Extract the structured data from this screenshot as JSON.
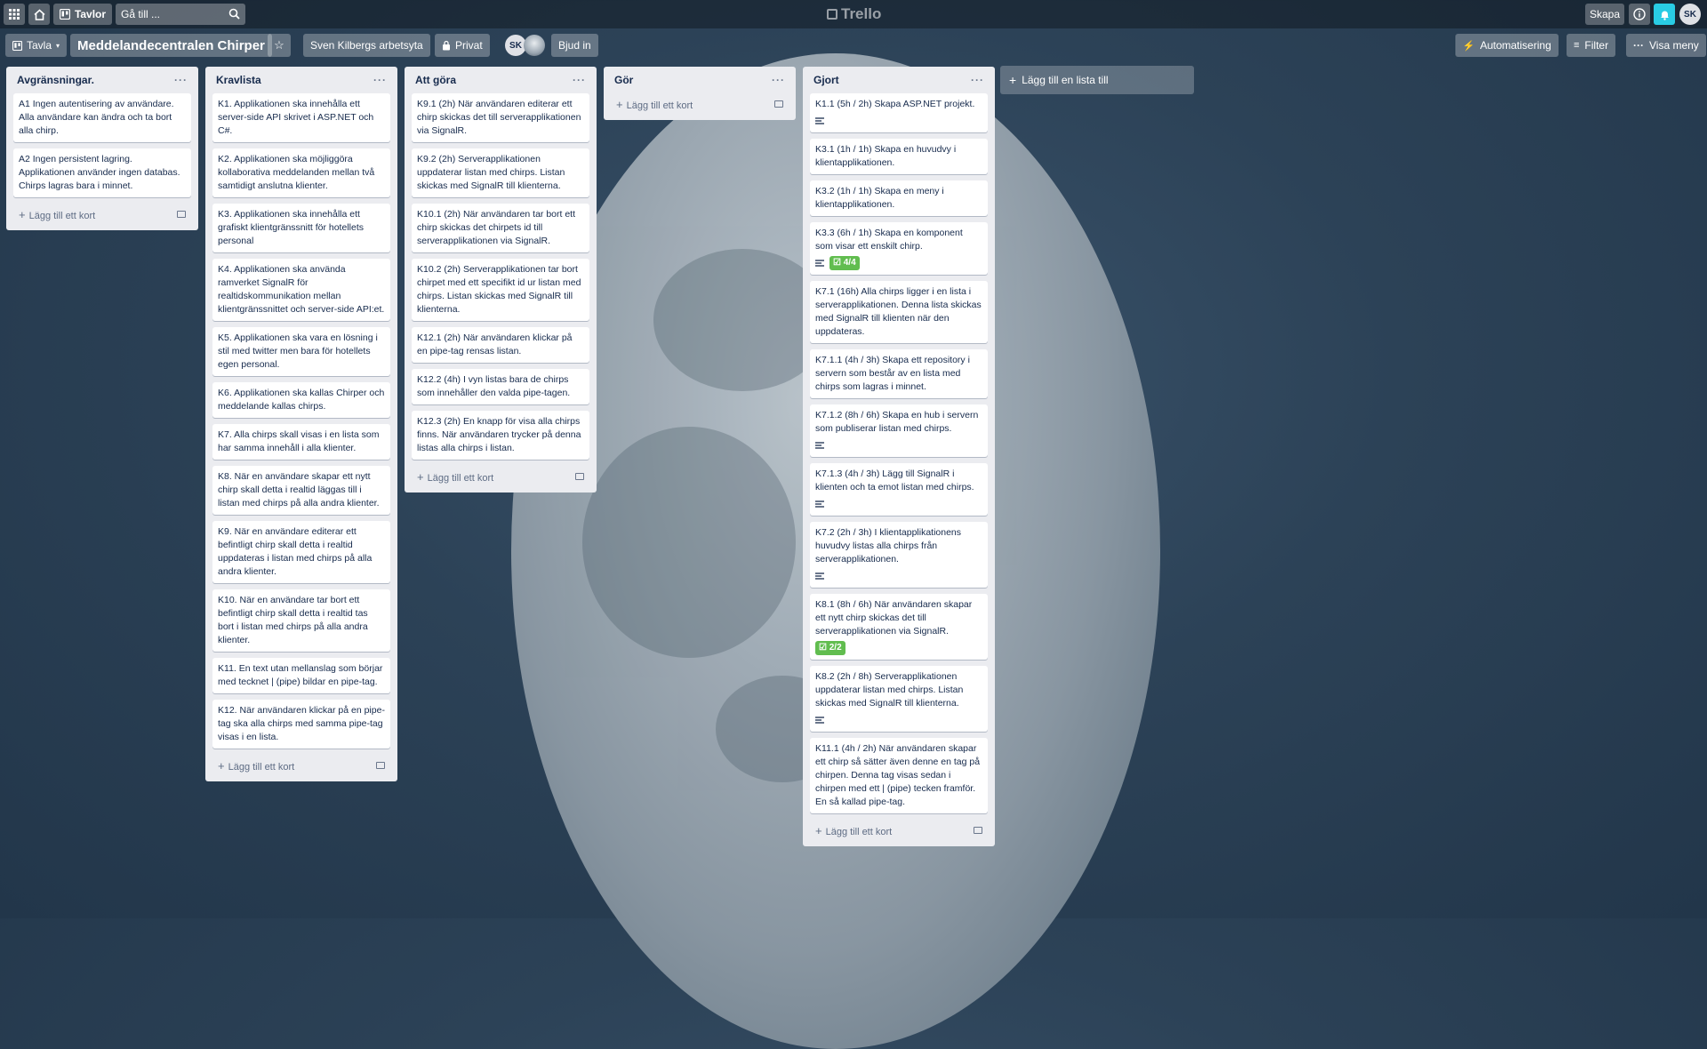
{
  "header": {
    "boards_label": "Tavlor",
    "search_placeholder": "Gå till ...",
    "logo_text": "Trello",
    "create_label": "Skapa",
    "avatar_initials": "SK"
  },
  "board": {
    "view_label": "Tavla",
    "title": "Meddelandecentralen Chirper",
    "workspace_label": "Sven Kilbergs arbetsyta",
    "visibility_label": "Privat",
    "member_initials": "SK",
    "invite_label": "Bjud in",
    "automation_label": "Automatisering",
    "filter_label": "Filter",
    "menu_label": "Visa meny"
  },
  "add_card_label": "Lägg till ett kort",
  "add_list_label": "Lägg till en lista till",
  "lists": [
    {
      "title": "Avgränsningar.",
      "cards": [
        {
          "text": "A1 Ingen autentisering av användare. Alla användare kan ändra och ta bort alla chirp."
        },
        {
          "text": "A2 Ingen persistent lagring. Applikationen använder ingen databas. Chirps lagras bara i minnet."
        }
      ]
    },
    {
      "title": "Kravlista",
      "cards": [
        {
          "text": "K1. Applikationen ska innehålla ett server-side API skrivet i ASP.NET och C#."
        },
        {
          "text": "K2. Applikationen ska möjliggöra kollaborativa meddelanden mellan två samtidigt anslutna klienter."
        },
        {
          "text": "K3. Applikationen ska innehålla ett grafiskt klientgränssnitt för hotellets personal"
        },
        {
          "text": "K4. Applikationen ska använda ramverket SignalR för realtidskommunikation mellan klientgränssnittet och server-side API:et."
        },
        {
          "text": "K5. Applikationen ska vara en lösning i stil med twitter men bara för hotellets egen personal."
        },
        {
          "text": "K6. Applikationen ska kallas Chirper och meddelande kallas chirps."
        },
        {
          "text": "K7. Alla chirps skall visas i en lista som har samma innehåll i alla klienter."
        },
        {
          "text": "K8. När en användare skapar ett nytt chirp skall detta i realtid läggas till i listan med chirps på alla andra klienter."
        },
        {
          "text": "K9. När en användare editerar ett befintligt chirp skall detta i realtid uppdateras i listan med chirps på alla andra klienter."
        },
        {
          "text": "K10. När en användare tar bort ett befintligt chirp skall detta i realtid tas bort i listan med chirps på alla andra klienter."
        },
        {
          "text": "K11. En text utan mellanslag som börjar med tecknet | (pipe) bildar en pipe-tag."
        },
        {
          "text": "K12. När användaren klickar på en pipe-tag ska alla chirps med samma pipe-tag visas i en lista."
        }
      ]
    },
    {
      "title": "Att göra",
      "cards": [
        {
          "text": "K9.1 (2h) När användaren editerar ett chirp skickas det till serverapplikationen via SignalR."
        },
        {
          "text": "K9.2 (2h) Serverapplikationen uppdaterar listan med chirps. Listan skickas med SignalR till klienterna."
        },
        {
          "text": "K10.1 (2h) När användaren tar bort ett chirp skickas det chirpets id till serverapplikationen via SignalR."
        },
        {
          "text": "K10.2 (2h) Serverapplikationen tar bort chirpet med ett specifikt id ur listan med chirps. Listan skickas med SignalR till klienterna."
        },
        {
          "text": "K12.1 (2h) När användaren klickar på en pipe-tag rensas listan."
        },
        {
          "text": "K12.2 (4h) I vyn listas bara de chirps som innehåller den valda pipe-tagen."
        },
        {
          "text": "K12.3 (2h) En knapp för visa alla chirps finns. När användaren trycker på denna listas alla chirps i listan."
        }
      ]
    },
    {
      "title": "Gör",
      "cards": []
    },
    {
      "title": "Gjort",
      "cards": [
        {
          "text": "K1.1 (5h / 2h) Skapa ASP.NET projekt.",
          "desc": true
        },
        {
          "text": "K3.1 (1h / 1h) Skapa en huvudvy i klientapplikationen."
        },
        {
          "text": "K3.2 (1h / 1h) Skapa en meny i klientapplikationen."
        },
        {
          "text": "K3.3 (6h / 1h) Skapa en komponent som visar ett enskilt chirp.",
          "desc": true,
          "checklist": "4/4"
        },
        {
          "text": "K7.1 (16h) Alla chirps ligger i en lista i serverapplikationen. Denna lista skickas med SignalR till klienten när den uppdateras."
        },
        {
          "text": "K7.1.1 (4h / 3h) Skapa ett repository i servern som består av en lista med chirps som lagras i minnet."
        },
        {
          "text": "K7.1.2 (8h / 6h) Skapa en hub i servern som publiserar listan med chirps.",
          "desc": true
        },
        {
          "text": "K7.1.3 (4h / 3h) Lägg till SignalR i klienten och ta emot listan med chirps.",
          "desc": true
        },
        {
          "text": "K7.2 (2h / 3h) I klientapplikationens huvudvy listas alla chirps från serverapplikationen.",
          "desc": true
        },
        {
          "text": "K8.1 (8h / 6h) När användaren skapar ett nytt chirp skickas det till serverapplikationen via SignalR.",
          "checklist": "2/2"
        },
        {
          "text": "K8.2 (2h / 8h) Serverapplikationen uppdaterar listan med chirps. Listan skickas med SignalR till klienterna.",
          "desc": true
        },
        {
          "text": "K11.1 (4h / 2h) När användaren skapar ett chirp så sätter även denne en tag på chirpen. Denna tag visas sedan i chirpen med ett | (pipe) tecken framför. En så kallad pipe-tag."
        }
      ]
    }
  ]
}
